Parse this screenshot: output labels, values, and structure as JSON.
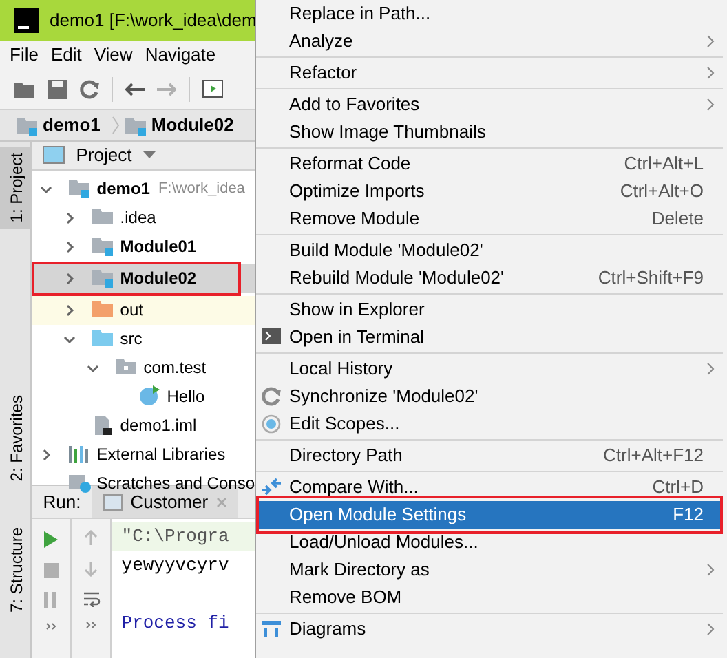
{
  "window": {
    "title": "demo1 [F:\\work_idea\\dem"
  },
  "menu_bar": [
    "File",
    "Edit",
    "View",
    "Navigate"
  ],
  "breadcrumbs": [
    {
      "label": "demo1"
    },
    {
      "label": "Module02"
    }
  ],
  "tool_window_stripe": [
    {
      "label": "1: Project",
      "selected": true
    },
    {
      "label": "2: Favorites",
      "selected": false
    },
    {
      "label": "7: Structure",
      "selected": false
    }
  ],
  "project_panel": {
    "title": "Project",
    "tree": [
      {
        "label": "demo1",
        "hint": "F:\\work_idea",
        "kind": "module",
        "expanded": true,
        "selected": false,
        "annotated": false,
        "children": [
          {
            "label": ".idea",
            "kind": "folder",
            "expanded": false,
            "selected": false,
            "annotated": false
          },
          {
            "label": "Module01",
            "kind": "module",
            "expanded": false,
            "selected": false,
            "annotated": false
          },
          {
            "label": "Module02",
            "kind": "module",
            "expanded": false,
            "selected": true,
            "annotated": true
          },
          {
            "label": "out",
            "kind": "excluded",
            "expanded": false,
            "selected": false,
            "annotated": false
          },
          {
            "label": "src",
            "kind": "source",
            "expanded": true,
            "selected": false,
            "annotated": false,
            "children": [
              {
                "label": "com.test",
                "kind": "package",
                "expanded": true,
                "selected": false,
                "annotated": false,
                "children": [
                  {
                    "label": "Hello",
                    "kind": "class",
                    "selected": false,
                    "annotated": false
                  }
                ]
              }
            ]
          },
          {
            "label": "demo1.iml",
            "kind": "iml",
            "selected": false,
            "annotated": false
          }
        ]
      },
      {
        "label": "External Libraries",
        "kind": "libraries",
        "expanded": false,
        "selected": false,
        "annotated": false
      },
      {
        "label": "Scratches and Conso",
        "kind": "scratches",
        "selected": false,
        "annotated": false
      }
    ]
  },
  "run_panel": {
    "label": "Run:",
    "tab": "Customer",
    "console": [
      {
        "text": "\"C:\\Progra",
        "kind": "command"
      },
      {
        "text": "yewyyvcyrv",
        "kind": "output"
      },
      {
        "text": "Process fi",
        "kind": "exit"
      }
    ]
  },
  "context_menu": {
    "groups": [
      [
        {
          "label": "Replace in Path...",
          "kind": "plain",
          "submenu": false,
          "selected": false,
          "annotated": false
        },
        {
          "label": "Analyze",
          "kind": "plain",
          "submenu": true,
          "selected": false,
          "annotated": false
        }
      ],
      [
        {
          "label": "Refactor",
          "kind": "plain",
          "submenu": true,
          "selected": false,
          "annotated": false
        }
      ],
      [
        {
          "label": "Add to Favorites",
          "kind": "plain",
          "submenu": true,
          "selected": false,
          "annotated": false
        },
        {
          "label": "Show Image Thumbnails",
          "kind": "plain",
          "submenu": false,
          "selected": false,
          "annotated": false
        }
      ],
      [
        {
          "label": "Reformat Code",
          "shortcut": "Ctrl+Alt+L",
          "kind": "plain",
          "submenu": false,
          "selected": false,
          "annotated": false
        },
        {
          "label": "Optimize Imports",
          "shortcut": "Ctrl+Alt+O",
          "kind": "plain",
          "submenu": false,
          "selected": false,
          "annotated": false
        },
        {
          "label": "Remove Module",
          "shortcut": "Delete",
          "kind": "plain",
          "submenu": false,
          "selected": false,
          "annotated": false
        }
      ],
      [
        {
          "label": "Build Module 'Module02'",
          "kind": "plain",
          "submenu": false,
          "selected": false,
          "annotated": false
        },
        {
          "label": "Rebuild Module 'Module02'",
          "shortcut": "Ctrl+Shift+F9",
          "kind": "plain",
          "submenu": false,
          "selected": false,
          "annotated": false
        }
      ],
      [
        {
          "label": "Show in Explorer",
          "kind": "plain",
          "submenu": false,
          "selected": false,
          "annotated": false
        },
        {
          "label": "Open in Terminal",
          "kind": "terminal",
          "submenu": false,
          "selected": false,
          "annotated": false
        }
      ],
      [
        {
          "label": "Local History",
          "kind": "plain",
          "submenu": true,
          "selected": false,
          "annotated": false
        },
        {
          "label": "Synchronize 'Module02'",
          "kind": "sync",
          "submenu": false,
          "selected": false,
          "annotated": false
        },
        {
          "label": "Edit Scopes...",
          "kind": "scope",
          "submenu": false,
          "selected": false,
          "annotated": false
        }
      ],
      [
        {
          "label": "Directory Path",
          "shortcut": "Ctrl+Alt+F12",
          "kind": "plain",
          "submenu": false,
          "selected": false,
          "annotated": false
        }
      ],
      [
        {
          "label": "Compare With...",
          "shortcut": "Ctrl+D",
          "kind": "compare",
          "submenu": false,
          "selected": false,
          "annotated": false
        },
        {
          "label": "Open Module Settings",
          "shortcut": "F12",
          "kind": "plain",
          "submenu": false,
          "selected": true,
          "annotated": true
        },
        {
          "label": "Load/Unload Modules...",
          "kind": "plain",
          "submenu": false,
          "selected": false,
          "annotated": false
        },
        {
          "label": "Mark Directory as",
          "kind": "plain",
          "submenu": true,
          "selected": false,
          "annotated": false
        },
        {
          "label": "Remove BOM",
          "kind": "plain",
          "submenu": false,
          "selected": false,
          "annotated": false
        }
      ],
      [
        {
          "label": "Diagrams",
          "kind": "diagram",
          "submenu": true,
          "selected": false,
          "annotated": false
        }
      ]
    ]
  }
}
